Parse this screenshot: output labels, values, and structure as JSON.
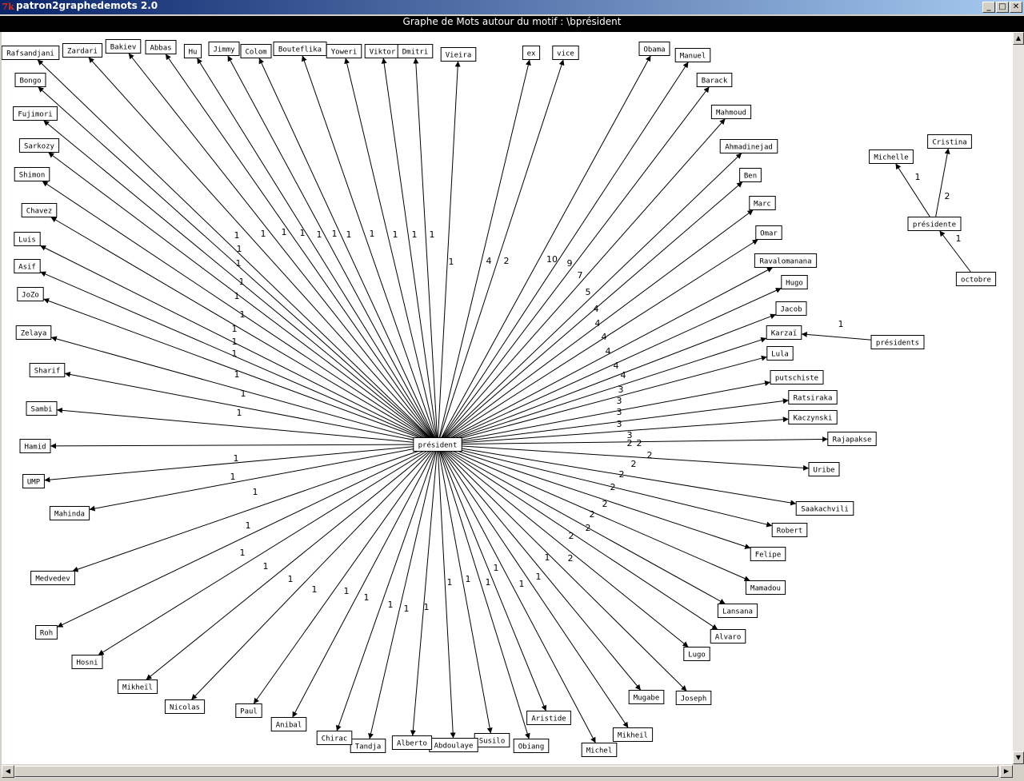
{
  "window": {
    "title": "patron2graphedemots 2.0",
    "icon": "tk-feather-icon",
    "controls": [
      "minimize-icon",
      "maximize-icon",
      "close-icon"
    ]
  },
  "header": {
    "text": "Graphe de Mots autour du motif : \\bprésident"
  },
  "graph": {
    "center": {
      "label": "président"
    },
    "nodes": [
      {
        "label": "Rafsandjani",
        "count": "1"
      },
      {
        "label": "Zardari",
        "count": "1"
      },
      {
        "label": "Bakiev",
        "count": "1"
      },
      {
        "label": "Abbas",
        "count": "1"
      },
      {
        "label": "Hu",
        "count": "1"
      },
      {
        "label": "Jimmy",
        "count": "1"
      },
      {
        "label": "Colom",
        "count": "1"
      },
      {
        "label": "Bouteflika",
        "count": "1"
      },
      {
        "label": "Yoweri",
        "count": "1"
      },
      {
        "label": "Viktor",
        "count": "1"
      },
      {
        "label": "Dmitri",
        "count": "1"
      },
      {
        "label": "Vieira",
        "count": "1"
      },
      {
        "label": "ex",
        "count": "4"
      },
      {
        "label": "vice",
        "count": "2"
      },
      {
        "label": "Obama",
        "count": "10"
      },
      {
        "label": "Manuel",
        "count": "9"
      },
      {
        "label": "Barack",
        "count": "7"
      },
      {
        "label": "Mahmoud",
        "count": "5"
      },
      {
        "label": "Ahmadinejad",
        "count": "4"
      },
      {
        "label": "Ben",
        "count": "4"
      },
      {
        "label": "Marc",
        "count": "4"
      },
      {
        "label": "Omar",
        "count": "4"
      },
      {
        "label": "Ravalomanana",
        "count": "4"
      },
      {
        "label": "Hugo",
        "count": "4"
      },
      {
        "label": "Jacob",
        "count": "3"
      },
      {
        "label": "Karzaï",
        "count": "3"
      },
      {
        "label": "Lula",
        "count": "3"
      },
      {
        "label": "putschiste",
        "count": "3"
      },
      {
        "label": "Ratsiraka",
        "count": "3"
      },
      {
        "label": "Kaczynski",
        "count": "2"
      },
      {
        "label": "Rajapakse",
        "count": "2"
      },
      {
        "label": "Uribe",
        "count": "2"
      },
      {
        "label": "Saakachvili",
        "count": "2"
      },
      {
        "label": "Robert",
        "count": "2"
      },
      {
        "label": "Felipe",
        "count": "2"
      },
      {
        "label": "Mamadou",
        "count": "2"
      },
      {
        "label": "Lansana",
        "count": "2"
      },
      {
        "label": "Alvaro",
        "count": "2"
      },
      {
        "label": "Lugo",
        "count": "2"
      },
      {
        "label": "Joseph",
        "count": "2"
      },
      {
        "label": "Mugabe",
        "count": "1"
      },
      {
        "label": "Mikheil",
        "count": "1"
      },
      {
        "label": "Michel",
        "count": "1"
      },
      {
        "label": "Aristide",
        "count": "1"
      },
      {
        "label": "Obiang",
        "count": "1"
      },
      {
        "label": "Susilo",
        "count": "1"
      },
      {
        "label": "Abdoulaye",
        "count": "1"
      },
      {
        "label": "Alberto",
        "count": "1"
      },
      {
        "label": "Tandja",
        "count": "1"
      },
      {
        "label": "Chirac",
        "count": "1"
      },
      {
        "label": "Anibal",
        "count": "1"
      },
      {
        "label": "Paul",
        "count": "1"
      },
      {
        "label": "Nicolas",
        "count": "1"
      },
      {
        "label": "Mikheïl",
        "count": "1"
      },
      {
        "label": "Hosni",
        "count": "1"
      },
      {
        "label": "Roh",
        "count": "1"
      },
      {
        "label": "Medvedev",
        "count": "1"
      },
      {
        "label": "Mahinda",
        "count": "1"
      },
      {
        "label": "UMP",
        "count": "1"
      },
      {
        "label": "Hamid",
        "count": "1"
      },
      {
        "label": "Sambi",
        "count": "1"
      },
      {
        "label": "Sharif",
        "count": "1"
      },
      {
        "label": "Zelaya",
        "count": "1"
      },
      {
        "label": "JoZo",
        "count": "1"
      },
      {
        "label": "Asif",
        "count": "1"
      },
      {
        "label": "Luis",
        "count": "1"
      },
      {
        "label": "Chavez",
        "count": "1"
      },
      {
        "label": "Shimon",
        "count": "1"
      },
      {
        "label": "Sarkozy",
        "count": "1"
      },
      {
        "label": "Fujimori",
        "count": "1"
      },
      {
        "label": "Bongo",
        "count": "1"
      }
    ],
    "extra_nodes": [
      {
        "label": "présidente"
      },
      {
        "label": "Michelle"
      },
      {
        "label": "Cristina"
      },
      {
        "label": "octobre"
      },
      {
        "label": "présidents"
      }
    ],
    "extra_edges": [
      {
        "from": "présidente",
        "to": "Michelle",
        "count": "1"
      },
      {
        "from": "présidente",
        "to": "Cristina",
        "count": "2"
      },
      {
        "from": "octobre",
        "to": "présidente",
        "count": "1"
      },
      {
        "from": "présidents",
        "to": "Karzaï",
        "count": "1"
      }
    ]
  },
  "scrollbars": {
    "vertical_up": "▲",
    "vertical_down": "▼",
    "horizontal_left": "◀",
    "horizontal_right": "▶"
  }
}
